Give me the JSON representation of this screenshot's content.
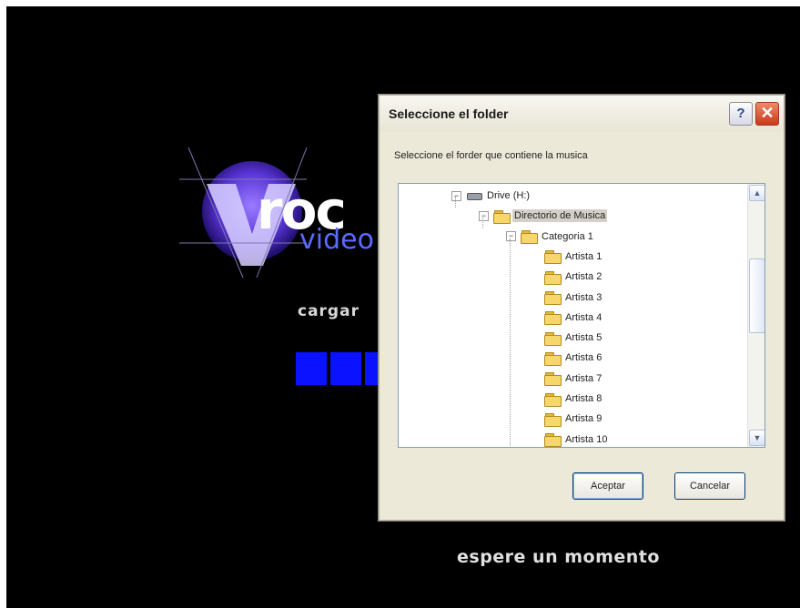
{
  "background": {
    "logo": {
      "word1": "roc",
      "word2": "video"
    },
    "loading_text": "cargar",
    "progress_blocks": 3,
    "footer_text": "espere un momento",
    "accent_color": "#0b12ff"
  },
  "dialog": {
    "title": "Seleccione el folder",
    "help_label": "?",
    "close_label": "✕",
    "description": "Seleccione el forder que contiene la musica",
    "tree": [
      {
        "label": "Drive (H:)",
        "icon": "drive-icon",
        "expander": "−"
      },
      {
        "label": "Directorio de Musica",
        "icon": "folder-icon",
        "expander": "−",
        "selected": true
      },
      {
        "label": "Categoria 1",
        "icon": "folder-icon",
        "expander": "−"
      },
      {
        "label": "Artista 1",
        "icon": "folder-icon"
      },
      {
        "label": "Artista 2",
        "icon": "folder-icon"
      },
      {
        "label": "Artista 3",
        "icon": "folder-icon"
      },
      {
        "label": "Artista 4",
        "icon": "folder-icon"
      },
      {
        "label": "Artista 5",
        "icon": "folder-icon"
      },
      {
        "label": "Artista 6",
        "icon": "folder-icon"
      },
      {
        "label": "Artista 7",
        "icon": "folder-icon"
      },
      {
        "label": "Artista 8",
        "icon": "folder-icon"
      },
      {
        "label": "Artista 9",
        "icon": "folder-icon"
      },
      {
        "label": "Artista 10",
        "icon": "folder-icon"
      }
    ],
    "scroll_up": "▲",
    "scroll_down": "▼",
    "accept_label": "Aceptar",
    "cancel_label": "Cancelar"
  }
}
